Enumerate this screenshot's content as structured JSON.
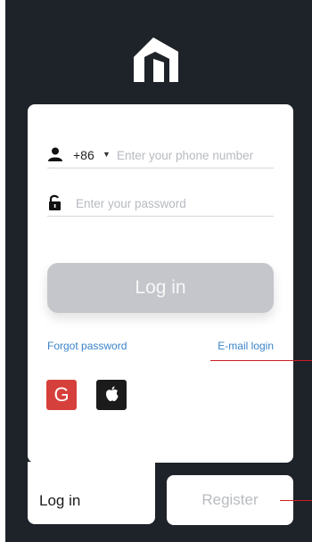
{
  "login": {
    "country_code": "+86",
    "phone_placeholder": "Enter your phone number",
    "password_placeholder": "Enter your password",
    "submit_label": "Log in",
    "forgot_password": "Forgot password",
    "email_login": "E-mail login"
  },
  "social": {
    "google_glyph": "G",
    "google_icon": "google-icon",
    "apple_icon": "apple-icon"
  },
  "tabs": {
    "login_label": "Log in",
    "register_label": "Register"
  },
  "colors": {
    "background": "#1e2229",
    "card": "#ffffff",
    "login_button": "#c4c6cb",
    "link": "#3a84c9",
    "google": "#d6403c",
    "apple": "#1b1b1b",
    "annotation_marker": "#cc1f26"
  }
}
